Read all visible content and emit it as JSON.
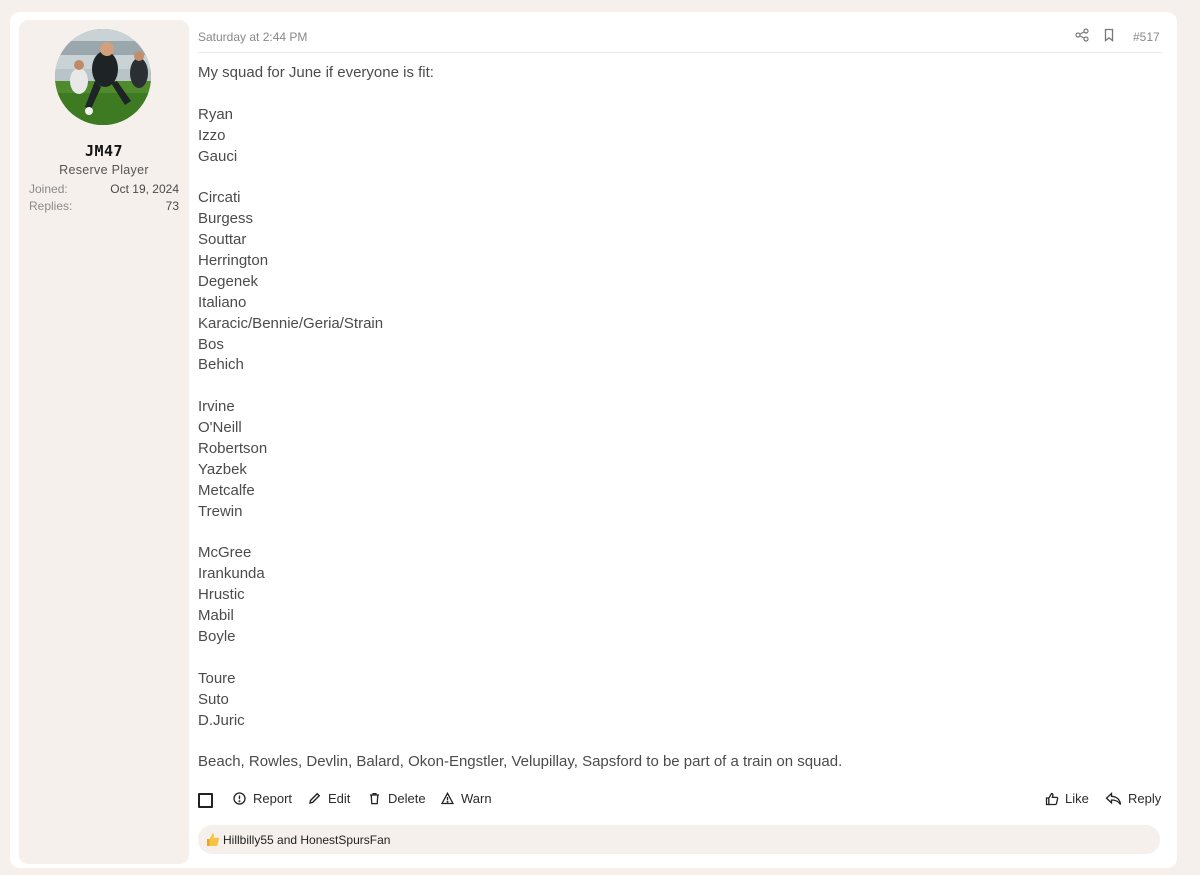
{
  "post": {
    "timestamp": "Saturday at 2:44 PM",
    "number": "#517",
    "body_lines": [
      "My squad for June if everyone is fit:",
      "",
      "Ryan",
      "Izzo",
      "Gauci",
      "",
      "Circati",
      "Burgess",
      "Souttar",
      "Herrington",
      "Degenek",
      "Italiano",
      "Karacic/Bennie/Geria/Strain",
      "Bos",
      "Behich",
      "",
      "Irvine",
      "O'Neill",
      "Robertson",
      "Yazbek",
      "Metcalfe",
      "Trewin",
      "",
      "McGree",
      "Irankunda",
      "Hrustic",
      "Mabil",
      "Boyle",
      "",
      "Toure",
      "Suto",
      "D.Juric",
      "",
      "Beach, Rowles, Devlin, Balard, Okon-Engstler, Velupillay, Sapsford to be part of a train on squad."
    ]
  },
  "user": {
    "name": "JM47",
    "title": "Reserve Player",
    "joined_label": "Joined:",
    "joined_value": "Oct 19, 2024",
    "replies_label": "Replies:",
    "replies_value": "73"
  },
  "actions": {
    "report": "Report",
    "edit": "Edit",
    "delete": "Delete",
    "warn": "Warn",
    "like": "Like",
    "reply": "Reply"
  },
  "reactions": {
    "text": "Hillbilly55 and HonestSpursFan"
  },
  "icons": {
    "share": "share-icon",
    "bookmark": "bookmark-icon",
    "report": "alert-circle-icon",
    "edit": "pencil-icon",
    "delete": "trash-icon",
    "warn": "warning-triangle-icon",
    "like": "thumbs-up-icon",
    "reply": "reply-arrow-icon",
    "reaction": "thumbs-up-emoji-icon"
  }
}
